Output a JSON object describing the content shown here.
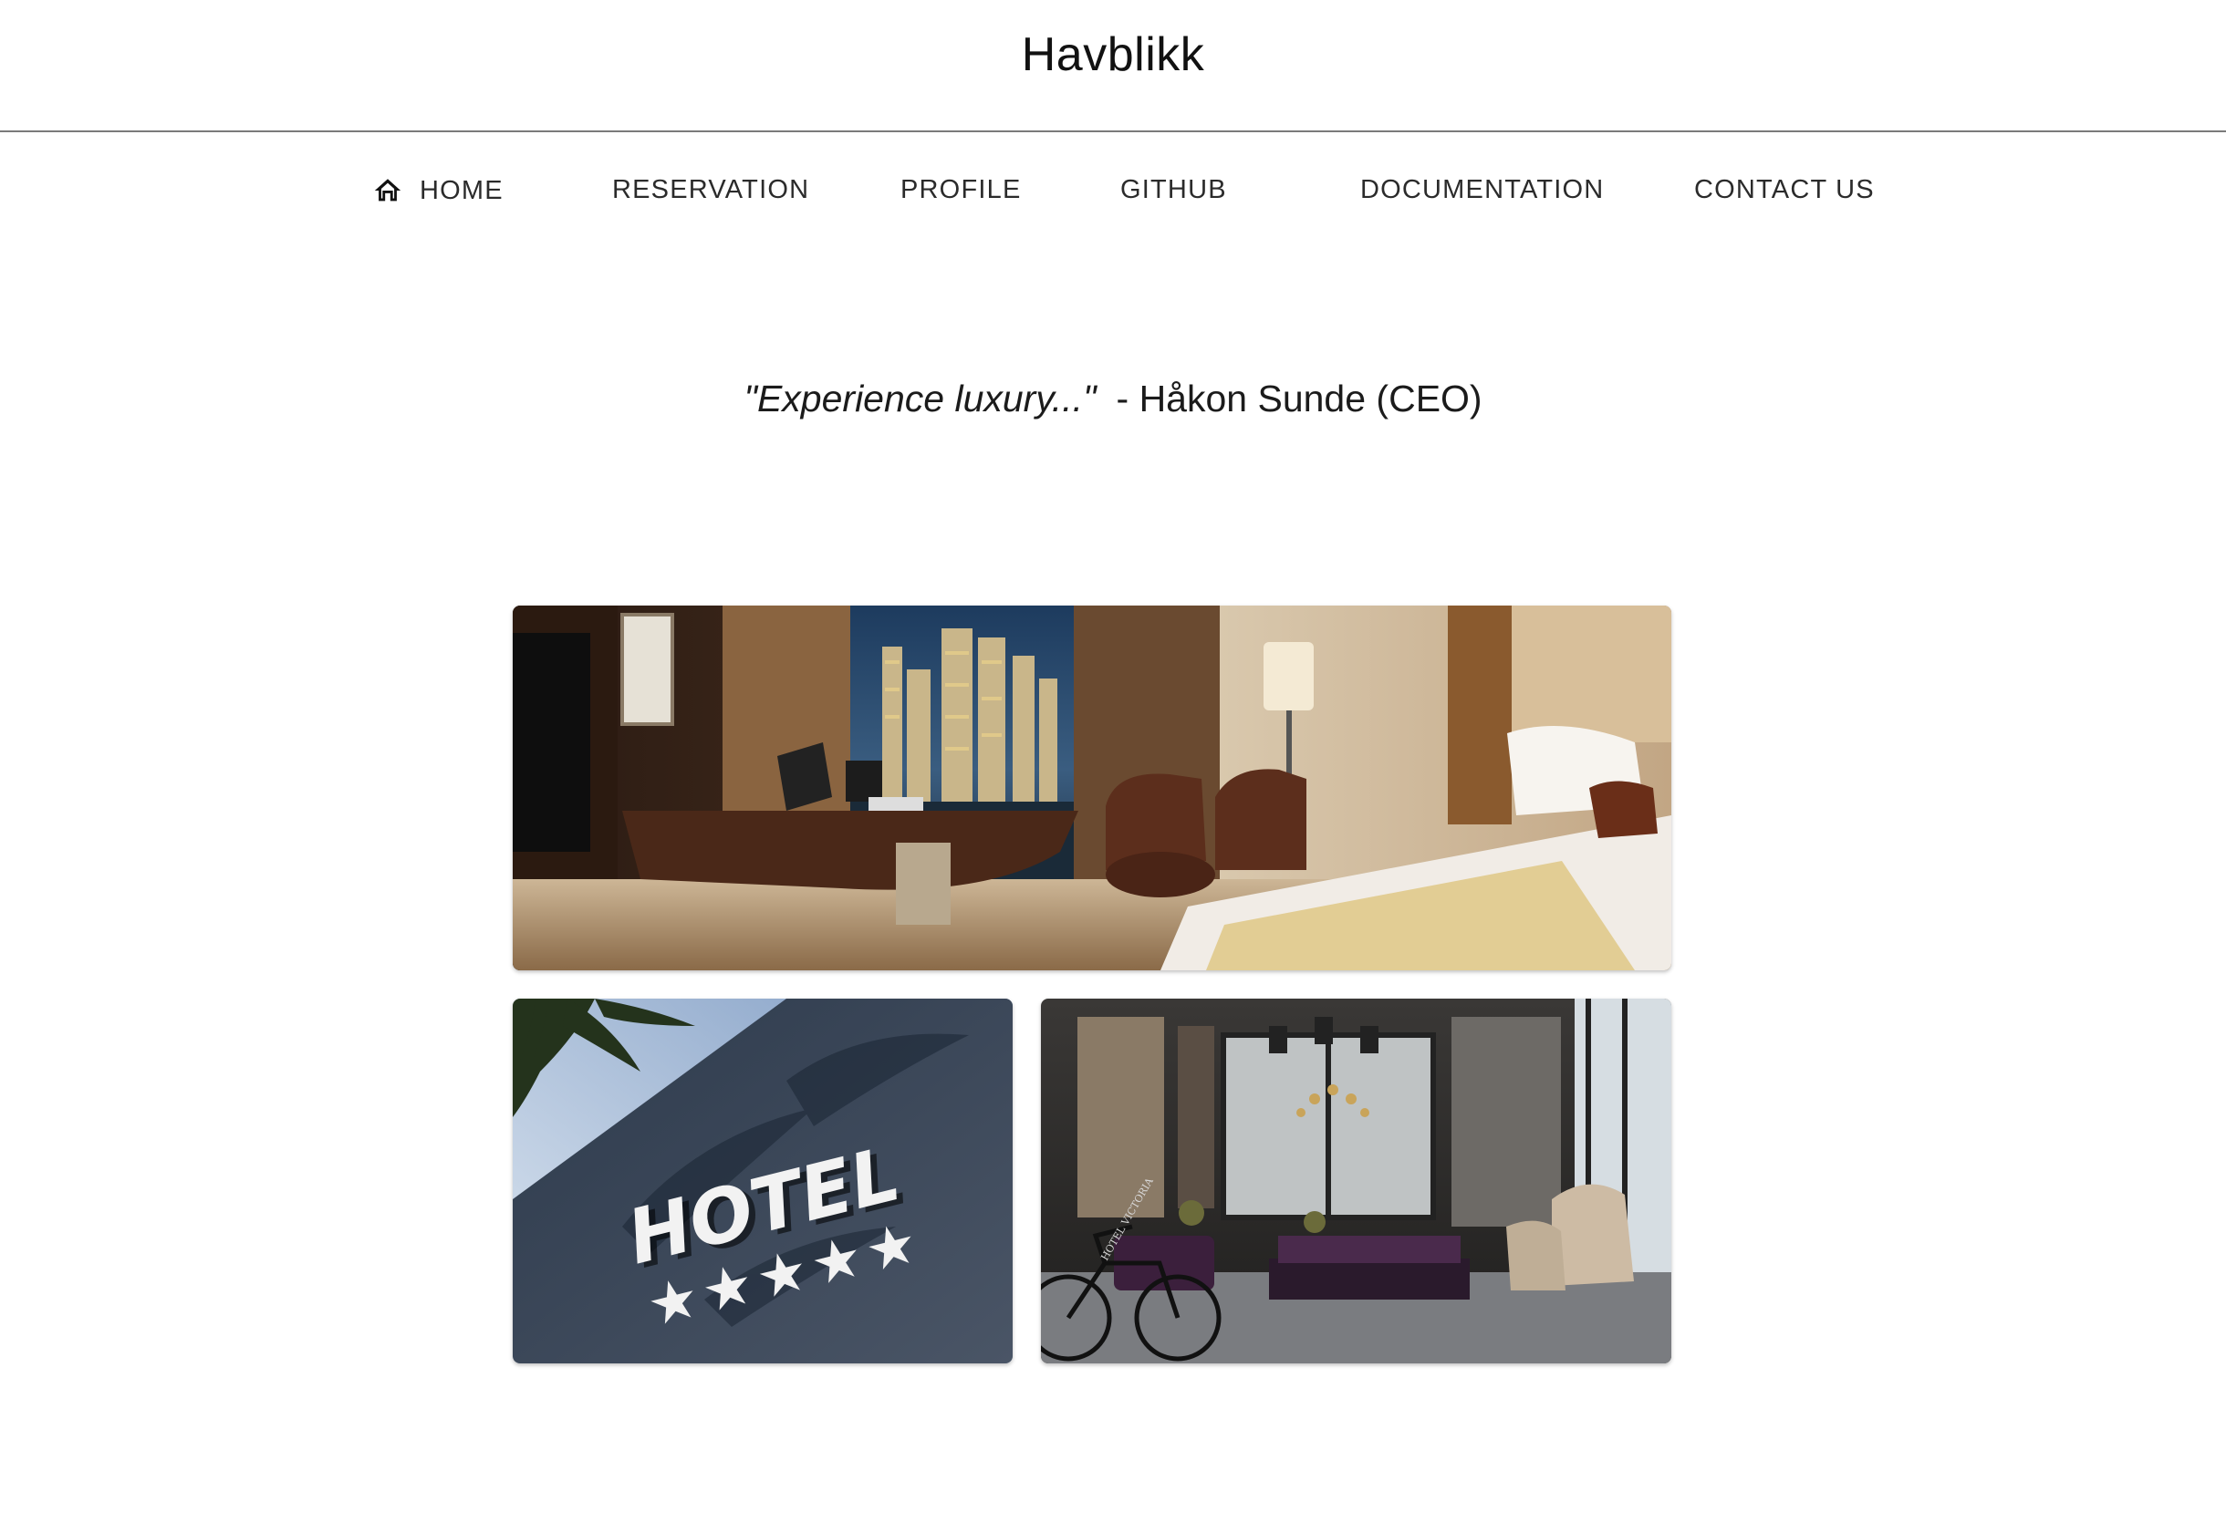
{
  "header": {
    "brand": "Havblikk"
  },
  "nav": {
    "items": [
      {
        "label": "HOME",
        "icon": "home-icon"
      },
      {
        "label": "RESERVATION"
      },
      {
        "label": "PROFILE"
      },
      {
        "label": "GITHUB"
      },
      {
        "label": "DOCUMENTATION"
      },
      {
        "label": "CONTACT US"
      }
    ]
  },
  "hero": {
    "quote": "\"Experience luxury...\"",
    "attribution": "- Håkon Sunde (CEO)"
  },
  "gallery": {
    "images": [
      {
        "subject": "hotel room with city view"
      },
      {
        "subject": "hotel sign with five stars",
        "sign_text": "HOTEL"
      },
      {
        "subject": "hotel lobby lounge",
        "sign_text": "HOTEL VICTORIA"
      }
    ]
  }
}
